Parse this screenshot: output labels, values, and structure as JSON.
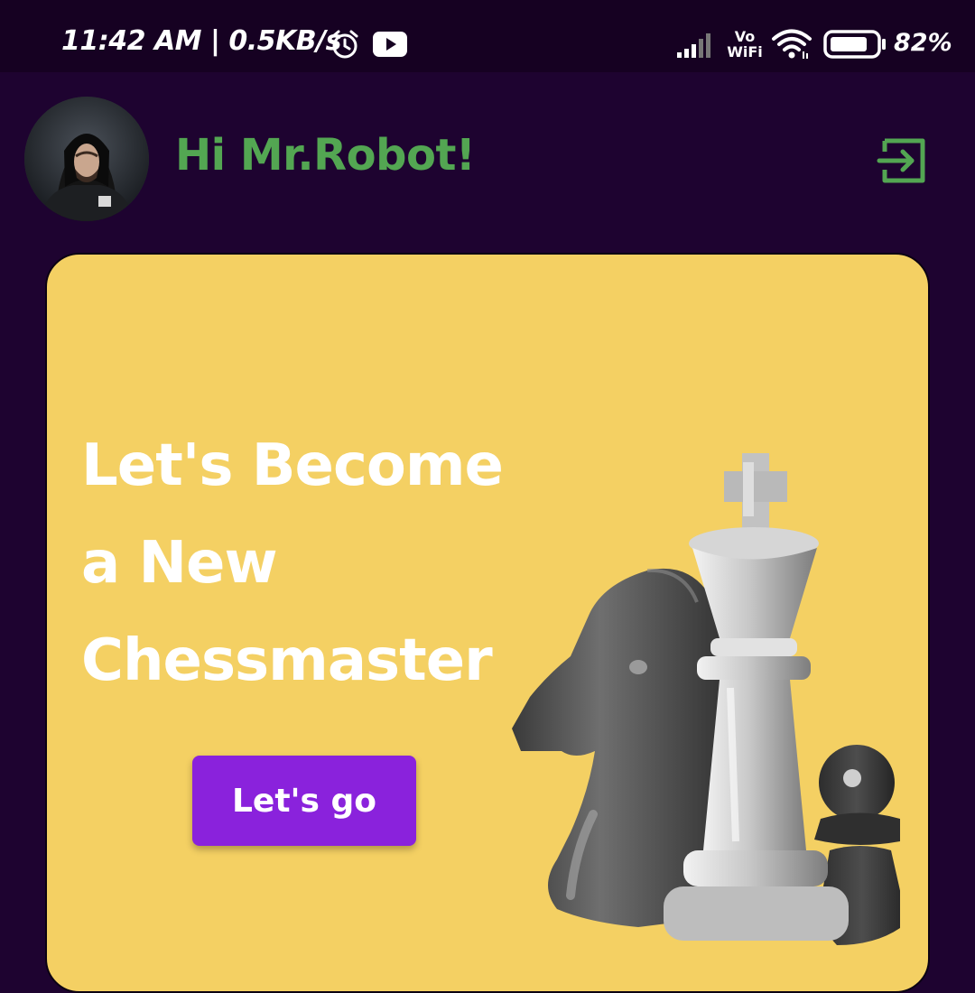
{
  "status_bar": {
    "time_text": "11:42 AM | 0.5KB/s",
    "battery_percent": "82%",
    "icons": [
      "alarm-icon",
      "youtube-icon",
      "signal-icon",
      "vowifi-icon",
      "wifi-icon",
      "battery-icon"
    ],
    "vowifi_label_top": "Vo",
    "vowifi_label_bottom": "WiFi"
  },
  "header": {
    "greeting": "Hi Mr.Robot!",
    "avatar_icon": "profile-avatar",
    "logout_icon": "logout-icon",
    "accent_color": "#53a652"
  },
  "hero_card": {
    "headline_lines": [
      "Let's Become",
      "a New",
      "Chessmaster"
    ],
    "cta_label": "Let's go",
    "background_color": "#f4d063",
    "cta_color": "#8a22dc",
    "illustration": "chess-pieces-icon"
  }
}
